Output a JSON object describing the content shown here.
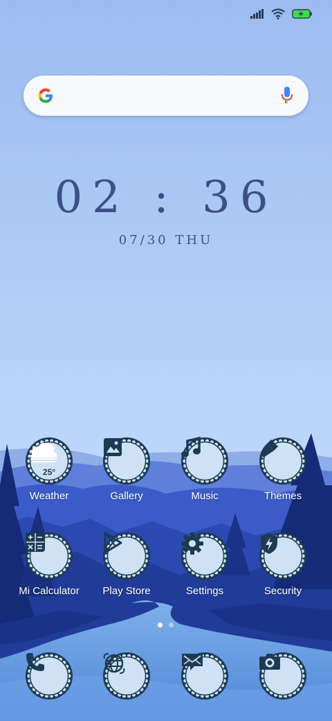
{
  "status_bar": {
    "icons": [
      "signal-icon",
      "wifi-icon",
      "battery-charging-icon"
    ],
    "battery_color": "#3ddc4a"
  },
  "search_widget": {
    "logo_icon": "google-g-icon",
    "voice_icon": "microphone-icon"
  },
  "clock_widget": {
    "time": "02:36",
    "date": "07/30 THU"
  },
  "home_apps": [
    {
      "label": "Weather",
      "icon": "weather-cloud-icon",
      "temperature": "25°"
    },
    {
      "label": "Gallery",
      "icon": "image-icon"
    },
    {
      "label": "Music",
      "icon": "music-note-icon"
    },
    {
      "label": "Themes",
      "icon": "paintbrush-icon"
    },
    {
      "label": "Mi Calculator",
      "icon": "calculator-icon"
    },
    {
      "label": "Play Store",
      "icon": "play-icon"
    },
    {
      "label": "Settings",
      "icon": "gear-icon"
    },
    {
      "label": "Security",
      "icon": "shield-bolt-icon"
    }
  ],
  "page_indicator": {
    "total": 2,
    "active": 1
  },
  "dock": [
    {
      "icon": "phone-icon"
    },
    {
      "icon": "browser-globe-icon"
    },
    {
      "icon": "messages-envelope-icon"
    },
    {
      "icon": "camera-icon"
    }
  ],
  "colors": {
    "icon_dark": "#1d3a52",
    "icon_light": "#cfe2f5",
    "clock_text": "#3d4f86",
    "sky_top": "#9cbcf0",
    "sky_bottom": "#bcd5fa"
  }
}
